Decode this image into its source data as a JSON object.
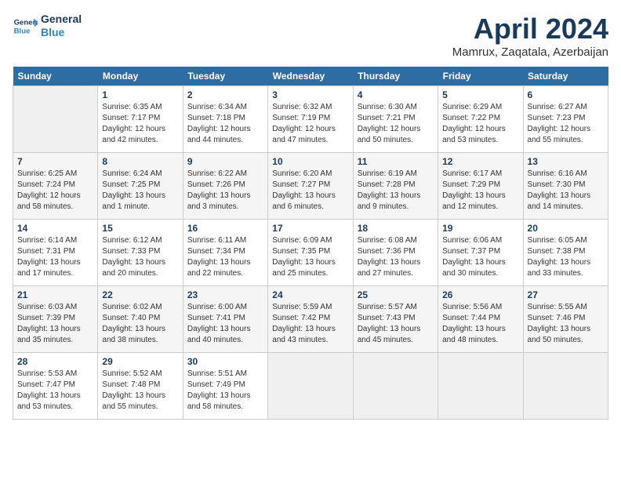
{
  "header": {
    "logo_line1": "General",
    "logo_line2": "Blue",
    "month_title": "April 2024",
    "location": "Mamrux, Zaqatala, Azerbaijan"
  },
  "days_of_week": [
    "Sunday",
    "Monday",
    "Tuesday",
    "Wednesday",
    "Thursday",
    "Friday",
    "Saturday"
  ],
  "weeks": [
    [
      {
        "day": "",
        "info": ""
      },
      {
        "day": "1",
        "info": "Sunrise: 6:35 AM\nSunset: 7:17 PM\nDaylight: 12 hours\nand 42 minutes."
      },
      {
        "day": "2",
        "info": "Sunrise: 6:34 AM\nSunset: 7:18 PM\nDaylight: 12 hours\nand 44 minutes."
      },
      {
        "day": "3",
        "info": "Sunrise: 6:32 AM\nSunset: 7:19 PM\nDaylight: 12 hours\nand 47 minutes."
      },
      {
        "day": "4",
        "info": "Sunrise: 6:30 AM\nSunset: 7:21 PM\nDaylight: 12 hours\nand 50 minutes."
      },
      {
        "day": "5",
        "info": "Sunrise: 6:29 AM\nSunset: 7:22 PM\nDaylight: 12 hours\nand 53 minutes."
      },
      {
        "day": "6",
        "info": "Sunrise: 6:27 AM\nSunset: 7:23 PM\nDaylight: 12 hours\nand 55 minutes."
      }
    ],
    [
      {
        "day": "7",
        "info": "Sunrise: 6:25 AM\nSunset: 7:24 PM\nDaylight: 12 hours\nand 58 minutes."
      },
      {
        "day": "8",
        "info": "Sunrise: 6:24 AM\nSunset: 7:25 PM\nDaylight: 13 hours\nand 1 minute."
      },
      {
        "day": "9",
        "info": "Sunrise: 6:22 AM\nSunset: 7:26 PM\nDaylight: 13 hours\nand 3 minutes."
      },
      {
        "day": "10",
        "info": "Sunrise: 6:20 AM\nSunset: 7:27 PM\nDaylight: 13 hours\nand 6 minutes."
      },
      {
        "day": "11",
        "info": "Sunrise: 6:19 AM\nSunset: 7:28 PM\nDaylight: 13 hours\nand 9 minutes."
      },
      {
        "day": "12",
        "info": "Sunrise: 6:17 AM\nSunset: 7:29 PM\nDaylight: 13 hours\nand 12 minutes."
      },
      {
        "day": "13",
        "info": "Sunrise: 6:16 AM\nSunset: 7:30 PM\nDaylight: 13 hours\nand 14 minutes."
      }
    ],
    [
      {
        "day": "14",
        "info": "Sunrise: 6:14 AM\nSunset: 7:31 PM\nDaylight: 13 hours\nand 17 minutes."
      },
      {
        "day": "15",
        "info": "Sunrise: 6:12 AM\nSunset: 7:33 PM\nDaylight: 13 hours\nand 20 minutes."
      },
      {
        "day": "16",
        "info": "Sunrise: 6:11 AM\nSunset: 7:34 PM\nDaylight: 13 hours\nand 22 minutes."
      },
      {
        "day": "17",
        "info": "Sunrise: 6:09 AM\nSunset: 7:35 PM\nDaylight: 13 hours\nand 25 minutes."
      },
      {
        "day": "18",
        "info": "Sunrise: 6:08 AM\nSunset: 7:36 PM\nDaylight: 13 hours\nand 27 minutes."
      },
      {
        "day": "19",
        "info": "Sunrise: 6:06 AM\nSunset: 7:37 PM\nDaylight: 13 hours\nand 30 minutes."
      },
      {
        "day": "20",
        "info": "Sunrise: 6:05 AM\nSunset: 7:38 PM\nDaylight: 13 hours\nand 33 minutes."
      }
    ],
    [
      {
        "day": "21",
        "info": "Sunrise: 6:03 AM\nSunset: 7:39 PM\nDaylight: 13 hours\nand 35 minutes."
      },
      {
        "day": "22",
        "info": "Sunrise: 6:02 AM\nSunset: 7:40 PM\nDaylight: 13 hours\nand 38 minutes."
      },
      {
        "day": "23",
        "info": "Sunrise: 6:00 AM\nSunset: 7:41 PM\nDaylight: 13 hours\nand 40 minutes."
      },
      {
        "day": "24",
        "info": "Sunrise: 5:59 AM\nSunset: 7:42 PM\nDaylight: 13 hours\nand 43 minutes."
      },
      {
        "day": "25",
        "info": "Sunrise: 5:57 AM\nSunset: 7:43 PM\nDaylight: 13 hours\nand 45 minutes."
      },
      {
        "day": "26",
        "info": "Sunrise: 5:56 AM\nSunset: 7:44 PM\nDaylight: 13 hours\nand 48 minutes."
      },
      {
        "day": "27",
        "info": "Sunrise: 5:55 AM\nSunset: 7:46 PM\nDaylight: 13 hours\nand 50 minutes."
      }
    ],
    [
      {
        "day": "28",
        "info": "Sunrise: 5:53 AM\nSunset: 7:47 PM\nDaylight: 13 hours\nand 53 minutes."
      },
      {
        "day": "29",
        "info": "Sunrise: 5:52 AM\nSunset: 7:48 PM\nDaylight: 13 hours\nand 55 minutes."
      },
      {
        "day": "30",
        "info": "Sunrise: 5:51 AM\nSunset: 7:49 PM\nDaylight: 13 hours\nand 58 minutes."
      },
      {
        "day": "",
        "info": ""
      },
      {
        "day": "",
        "info": ""
      },
      {
        "day": "",
        "info": ""
      },
      {
        "day": "",
        "info": ""
      }
    ]
  ]
}
